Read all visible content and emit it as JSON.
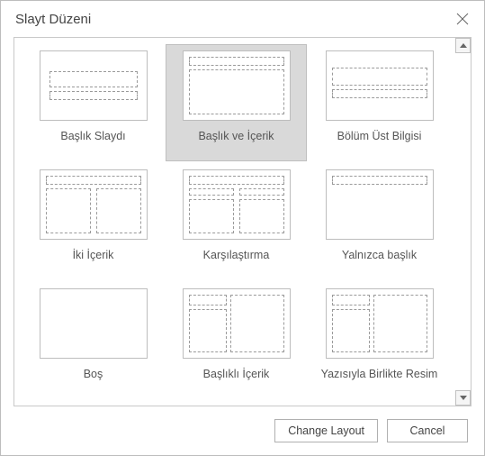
{
  "dialog": {
    "title": "Slayt Düzeni",
    "close_icon": "close"
  },
  "layouts": [
    {
      "id": "title-slide",
      "label": "Başlık Slaydı",
      "selected": false
    },
    {
      "id": "title-content",
      "label": "Başlık ve İçerik",
      "selected": true
    },
    {
      "id": "section-header",
      "label": "Bölüm Üst Bilgisi",
      "selected": false
    },
    {
      "id": "two-content",
      "label": "İki İçerik",
      "selected": false
    },
    {
      "id": "comparison",
      "label": "Karşılaştırma",
      "selected": false
    },
    {
      "id": "title-only",
      "label": "Yalnızca başlık",
      "selected": false
    },
    {
      "id": "blank",
      "label": "Boş",
      "selected": false
    },
    {
      "id": "content-caption",
      "label": "Başlıklı İçerik",
      "selected": false
    },
    {
      "id": "picture-caption",
      "label": "Yazısıyla Birlikte Resim",
      "selected": false
    }
  ],
  "buttons": {
    "primary": "Change Layout",
    "cancel": "Cancel"
  }
}
